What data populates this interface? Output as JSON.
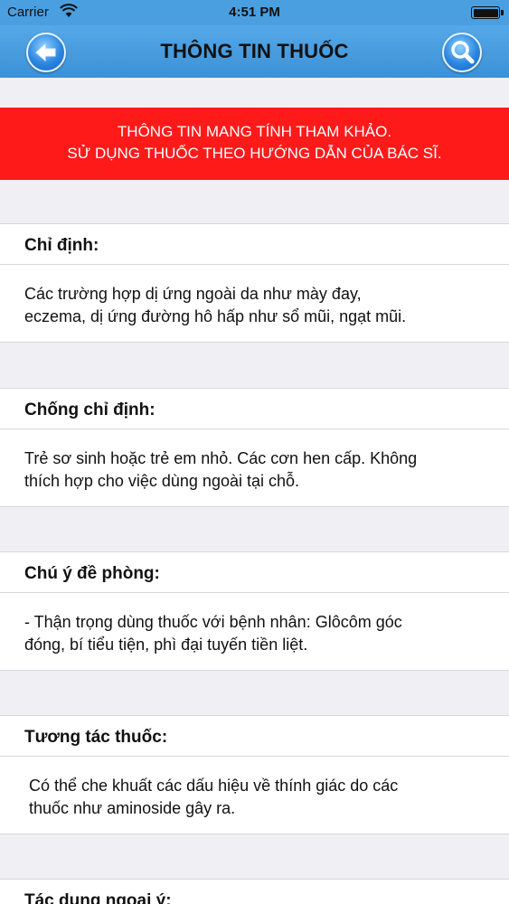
{
  "status_bar": {
    "carrier": "Carrier",
    "time": "4:51 PM"
  },
  "nav": {
    "title": "THÔNG TIN THUỐC",
    "back_icon": "back-arrow-icon",
    "search_icon": "search-icon"
  },
  "warning": {
    "line1": "THÔNG TIN MANG TÍNH THAM KHẢO.",
    "line2": "SỬ DỤNG THUỐC THEO HƯỚNG DẪN CỦA BÁC SĨ."
  },
  "sections": [
    {
      "title": "Chỉ định:",
      "line1": "Các trường hợp dị ứng ngoài da như mày đay,",
      "line2": "eczema, dị ứng đường hô hấp như sổ mũi, ngạt mũi."
    },
    {
      "title": "Chống chỉ định:",
      "line1": "Trẻ sơ sinh hoặc trẻ em nhỏ. Các cơn hen cấp. Không",
      "line2": "thích hợp cho việc dùng ngoài tại chỗ."
    },
    {
      "title": "Chú ý đề phòng:",
      "line1": "- Thận trọng dùng thuốc với bệnh nhân: Glôcôm góc",
      "line2": "đóng, bí tiểu tiện, phì đại tuyến tiền liệt."
    },
    {
      "title": "Tương tác thuốc:",
      "line1": "Có thể che khuất các dấu hiệu về thính giác do các",
      "line2": "thuốc như aminoside gây ra."
    },
    {
      "title": "Tác dụng ngoại ý:"
    }
  ],
  "colors": {
    "nav_blue": "#4a9fe0",
    "warning_red": "#ff1a1a",
    "background": "#efeff4"
  }
}
